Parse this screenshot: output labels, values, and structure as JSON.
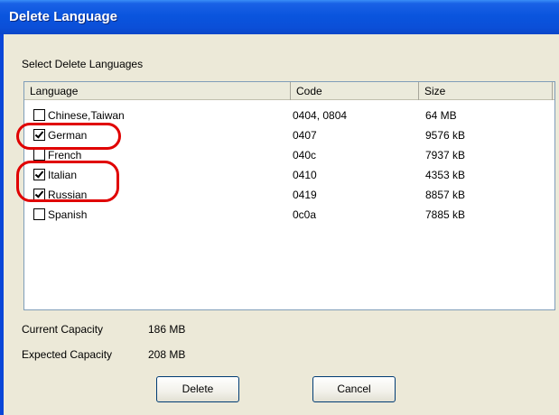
{
  "window": {
    "title": "Delete Language"
  },
  "group_label": "Select Delete Languages",
  "list": {
    "columns": [
      "Language",
      "Code",
      "Size"
    ],
    "rows": [
      {
        "language": "Chinese,Taiwan",
        "code": "0404, 0804",
        "size": "64 MB",
        "checked": false
      },
      {
        "language": "German",
        "code": "0407",
        "size": "9576 kB",
        "checked": true
      },
      {
        "language": "French",
        "code": "040c",
        "size": "7937 kB",
        "checked": false
      },
      {
        "language": "Italian",
        "code": "0410",
        "size": "4353 kB",
        "checked": true
      },
      {
        "language": "Russian",
        "code": "0419",
        "size": "8857 kB",
        "checked": true
      },
      {
        "language": "Spanish",
        "code": "0c0a",
        "size": "7885 kB",
        "checked": false
      }
    ]
  },
  "capacity": {
    "current_label": "Current Capacity",
    "current_value": "186 MB",
    "expected_label": "Expected Capacity",
    "expected_value": "208 MB"
  },
  "buttons": {
    "delete": "Delete",
    "cancel": "Cancel"
  },
  "colors": {
    "titlebar": "#0a55de",
    "dialog_bg": "#ece9d8",
    "annotation": "#e00000"
  }
}
